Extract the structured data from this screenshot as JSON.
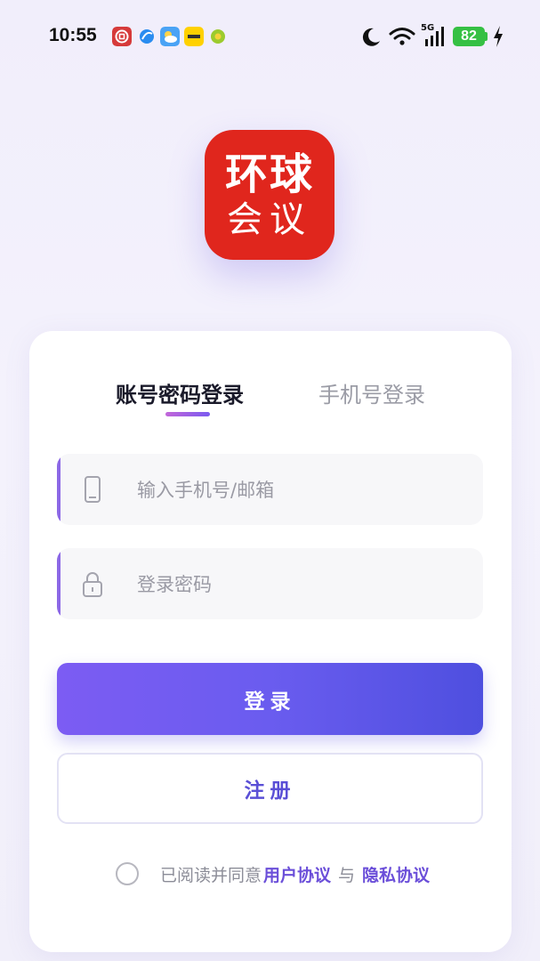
{
  "status_bar": {
    "time": "10:55",
    "battery": "82",
    "network": "5G"
  },
  "logo": {
    "line1": "环球",
    "line2": "会议"
  },
  "tabs": [
    {
      "label": "账号密码登录",
      "active": true
    },
    {
      "label": "手机号登录",
      "active": false
    }
  ],
  "form": {
    "account_placeholder": "输入手机号/邮箱",
    "account_value": "",
    "password_placeholder": "登录密码",
    "password_value": ""
  },
  "buttons": {
    "login": "登录",
    "register": "注册"
  },
  "agreement": {
    "prefix": "已阅读并同意",
    "user_agreement": "用户协议",
    "separator": "与",
    "privacy_policy": "隐私协议",
    "checked": false
  },
  "colors": {
    "accent": "#6a5cef",
    "logo_red": "#e0261d",
    "link": "#6b4fd9"
  }
}
